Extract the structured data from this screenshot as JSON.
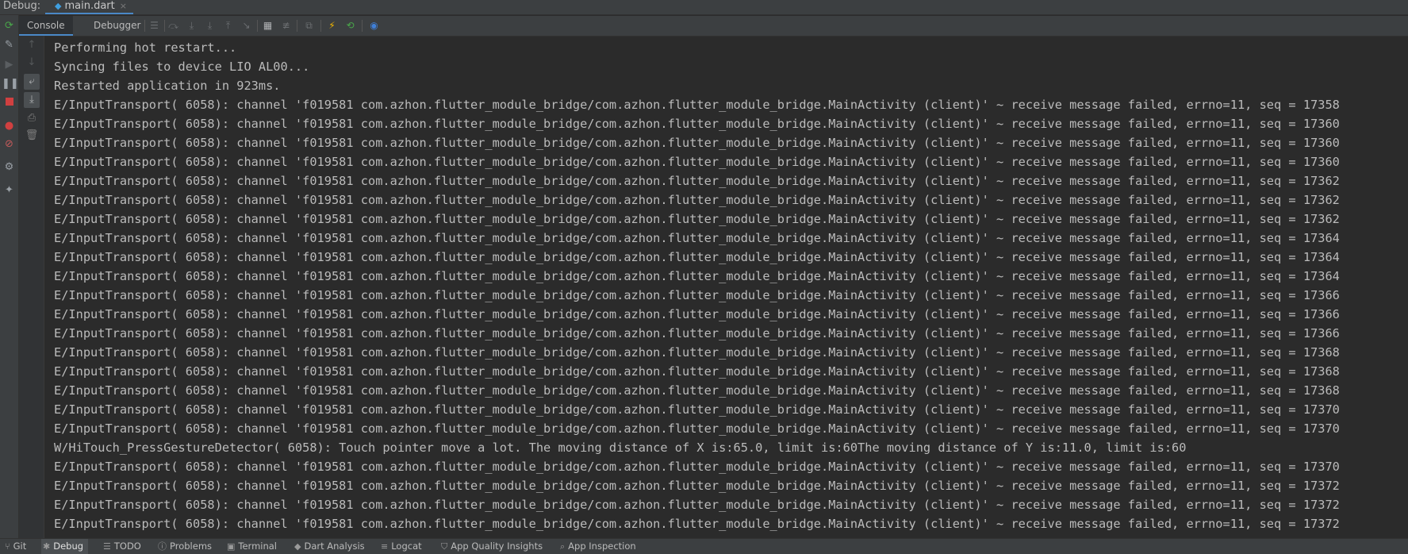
{
  "titlebar": {
    "label": "Debug:",
    "tab_name": "main.dart",
    "tab_close": "×"
  },
  "toolbar": {
    "tabs": [
      "Console",
      "Debugger"
    ]
  },
  "icons": {
    "left": [
      "rerun-icon",
      "wrench-icon",
      "resume-icon",
      "pause-icon",
      "stop-icon",
      "view-breakpoints-icon",
      "mute-breakpoints-icon",
      "settings-icon",
      "pin-icon"
    ],
    "gutter": [
      "up-arrow-icon",
      "down-arrow-icon",
      "soft-wrap-icon",
      "scroll-to-end-icon",
      "print-icon",
      "trash-icon"
    ],
    "toolbar": [
      "list-icon",
      "step-over-icon",
      "step-into-icon",
      "force-step-into-icon",
      "step-out-icon",
      "run-to-cursor-icon",
      "evaluate-icon",
      "trace-icon",
      "restore-layout-icon",
      "hot-reload-icon",
      "hot-restart-icon",
      "devtools-icon"
    ]
  },
  "colors": {
    "accent": "#4a88c7",
    "background": "#2b2b2b",
    "text": "#bbbbbb",
    "stop": "#d04040",
    "hot_reload": "#f5b800",
    "hot_restart": "#49a74a"
  },
  "console": {
    "lines": [
      "Performing hot restart...",
      "Syncing files to device LIO AL00...",
      "Restarted application in 923ms.",
      "E/InputTransport( 6058): channel 'f019581 com.azhon.flutter_module_bridge/com.azhon.flutter_module_bridge.MainActivity (client)' ~ receive message failed, errno=11, seq = 17358",
      "E/InputTransport( 6058): channel 'f019581 com.azhon.flutter_module_bridge/com.azhon.flutter_module_bridge.MainActivity (client)' ~ receive message failed, errno=11, seq = 17360",
      "E/InputTransport( 6058): channel 'f019581 com.azhon.flutter_module_bridge/com.azhon.flutter_module_bridge.MainActivity (client)' ~ receive message failed, errno=11, seq = 17360",
      "E/InputTransport( 6058): channel 'f019581 com.azhon.flutter_module_bridge/com.azhon.flutter_module_bridge.MainActivity (client)' ~ receive message failed, errno=11, seq = 17360",
      "E/InputTransport( 6058): channel 'f019581 com.azhon.flutter_module_bridge/com.azhon.flutter_module_bridge.MainActivity (client)' ~ receive message failed, errno=11, seq = 17362",
      "E/InputTransport( 6058): channel 'f019581 com.azhon.flutter_module_bridge/com.azhon.flutter_module_bridge.MainActivity (client)' ~ receive message failed, errno=11, seq = 17362",
      "E/InputTransport( 6058): channel 'f019581 com.azhon.flutter_module_bridge/com.azhon.flutter_module_bridge.MainActivity (client)' ~ receive message failed, errno=11, seq = 17362",
      "E/InputTransport( 6058): channel 'f019581 com.azhon.flutter_module_bridge/com.azhon.flutter_module_bridge.MainActivity (client)' ~ receive message failed, errno=11, seq = 17364",
      "E/InputTransport( 6058): channel 'f019581 com.azhon.flutter_module_bridge/com.azhon.flutter_module_bridge.MainActivity (client)' ~ receive message failed, errno=11, seq = 17364",
      "E/InputTransport( 6058): channel 'f019581 com.azhon.flutter_module_bridge/com.azhon.flutter_module_bridge.MainActivity (client)' ~ receive message failed, errno=11, seq = 17364",
      "E/InputTransport( 6058): channel 'f019581 com.azhon.flutter_module_bridge/com.azhon.flutter_module_bridge.MainActivity (client)' ~ receive message failed, errno=11, seq = 17366",
      "E/InputTransport( 6058): channel 'f019581 com.azhon.flutter_module_bridge/com.azhon.flutter_module_bridge.MainActivity (client)' ~ receive message failed, errno=11, seq = 17366",
      "E/InputTransport( 6058): channel 'f019581 com.azhon.flutter_module_bridge/com.azhon.flutter_module_bridge.MainActivity (client)' ~ receive message failed, errno=11, seq = 17366",
      "E/InputTransport( 6058): channel 'f019581 com.azhon.flutter_module_bridge/com.azhon.flutter_module_bridge.MainActivity (client)' ~ receive message failed, errno=11, seq = 17368",
      "E/InputTransport( 6058): channel 'f019581 com.azhon.flutter_module_bridge/com.azhon.flutter_module_bridge.MainActivity (client)' ~ receive message failed, errno=11, seq = 17368",
      "E/InputTransport( 6058): channel 'f019581 com.azhon.flutter_module_bridge/com.azhon.flutter_module_bridge.MainActivity (client)' ~ receive message failed, errno=11, seq = 17368",
      "E/InputTransport( 6058): channel 'f019581 com.azhon.flutter_module_bridge/com.azhon.flutter_module_bridge.MainActivity (client)' ~ receive message failed, errno=11, seq = 17370",
      "E/InputTransport( 6058): channel 'f019581 com.azhon.flutter_module_bridge/com.azhon.flutter_module_bridge.MainActivity (client)' ~ receive message failed, errno=11, seq = 17370",
      "W/HiTouch_PressGestureDetector( 6058): Touch pointer move a lot. The moving distance of X is:65.0, limit is:60The moving distance of Y is:11.0, limit is:60",
      "E/InputTransport( 6058): channel 'f019581 com.azhon.flutter_module_bridge/com.azhon.flutter_module_bridge.MainActivity (client)' ~ receive message failed, errno=11, seq = 17370",
      "E/InputTransport( 6058): channel 'f019581 com.azhon.flutter_module_bridge/com.azhon.flutter_module_bridge.MainActivity (client)' ~ receive message failed, errno=11, seq = 17372",
      "E/InputTransport( 6058): channel 'f019581 com.azhon.flutter_module_bridge/com.azhon.flutter_module_bridge.MainActivity (client)' ~ receive message failed, errno=11, seq = 17372",
      "E/InputTransport( 6058): channel 'f019581 com.azhon.flutter_module_bridge/com.azhon.flutter_module_bridge.MainActivity (client)' ~ receive message failed, errno=11, seq = 17372"
    ]
  },
  "bottombar": {
    "items": [
      {
        "label": "Git",
        "icon": "git-branch-icon"
      },
      {
        "label": "Debug",
        "icon": "bug-icon"
      },
      {
        "label": "TODO",
        "icon": "list-icon"
      },
      {
        "label": "Problems",
        "icon": "info-icon"
      },
      {
        "label": "Terminal",
        "icon": "terminal-icon"
      },
      {
        "label": "Dart Analysis",
        "icon": "dart-icon"
      },
      {
        "label": "Logcat",
        "icon": "logcat-icon"
      },
      {
        "label": "App Quality Insights",
        "icon": "shield-icon"
      },
      {
        "label": "App Inspection",
        "icon": "inspect-icon"
      }
    ]
  }
}
